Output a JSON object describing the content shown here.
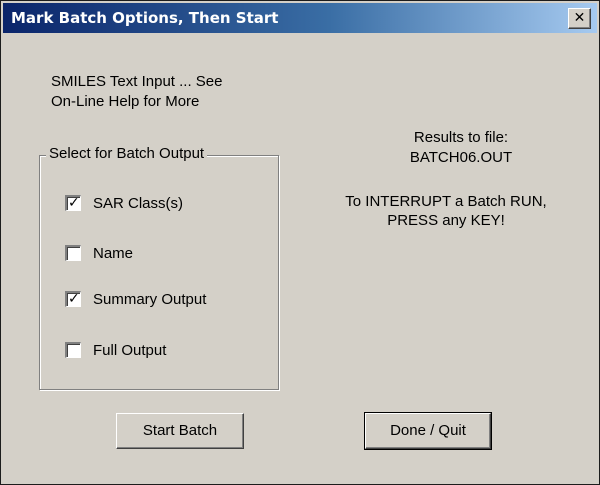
{
  "window": {
    "title": "Mark Batch Options, Then Start",
    "close_glyph": "✕",
    "close_icon": "close-icon"
  },
  "info": {
    "line1": "SMILES Text Input ... See",
    "line2": "On-Line Help for More"
  },
  "results": {
    "label": "Results to file:",
    "filename": "BATCH06.OUT"
  },
  "interrupt": {
    "line1": "To INTERRUPT a Batch RUN,",
    "line2": "PRESS any KEY!"
  },
  "output_group": {
    "legend": "Select for Batch Output",
    "options": [
      {
        "label": "SAR Class(s)",
        "checked": true,
        "mark": "✓"
      },
      {
        "label": "Name",
        "checked": false,
        "mark": ""
      },
      {
        "label": "Summary Output",
        "checked": true,
        "mark": "✓"
      },
      {
        "label": "Full Output",
        "checked": false,
        "mark": ""
      }
    ]
  },
  "buttons": {
    "start": "Start Batch",
    "done": "Done / Quit"
  },
  "colors": {
    "title_gradient_start": "#0a246a",
    "title_gradient_end": "#a6caf0",
    "face": "#d4d0c8"
  }
}
